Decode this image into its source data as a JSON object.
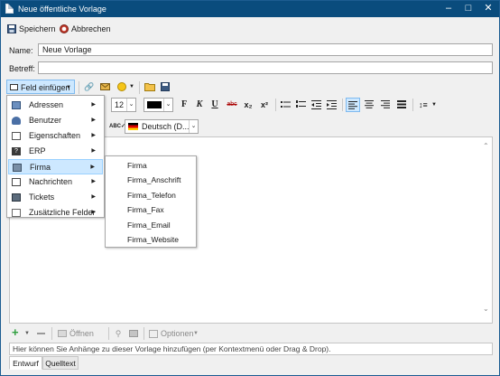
{
  "window": {
    "title": "Neue öffentliche Vorlage"
  },
  "toolbar": {
    "save_label": "Speichern",
    "cancel_label": "Abbrechen"
  },
  "form": {
    "name_label": "Name:",
    "name_value": "Neue Vorlage",
    "subject_label": "Betreff:",
    "subject_value": ""
  },
  "format": {
    "insert_field_label": "Feld einfügen",
    "font_size": "12",
    "language": "Deutsch (D...",
    "bold": "F",
    "italic": "K",
    "underline": "U",
    "strike": "abc",
    "subscript": "x₂",
    "superscript": "x²",
    "text_color": "#000000"
  },
  "menu": {
    "items": [
      {
        "label": "Adressen",
        "icon": "address-book-icon"
      },
      {
        "label": "Benutzer",
        "icon": "user-icon"
      },
      {
        "label": "Eigenschaften",
        "icon": "properties-icon"
      },
      {
        "label": "ERP",
        "icon": "erp-icon"
      },
      {
        "label": "Firma",
        "icon": "company-icon"
      },
      {
        "label": "Nachrichten",
        "icon": "mail-icon"
      },
      {
        "label": "Tickets",
        "icon": "ticket-icon"
      },
      {
        "label": "Zusätzliche Felder",
        "icon": "extra-fields-icon"
      }
    ],
    "selected": "Firma",
    "submenu": [
      "Firma",
      "Firma_Anschrift",
      "Firma_Telefon",
      "Firma_Fax",
      "Firma_Email",
      "Firma_Website"
    ]
  },
  "attachments": {
    "open_label": "Öffnen",
    "options_label": "Optionen",
    "hint": "Hier können Sie Anhänge zu dieser Vorlage hinzufügen (per Kontextmenü oder Drag & Drop)."
  },
  "tabs": [
    "Entwurf",
    "Quelltext"
  ],
  "colors": {
    "titlebar": "#0a4c7d",
    "accent": "#1e63b8",
    "selection": "#cde8ff"
  }
}
